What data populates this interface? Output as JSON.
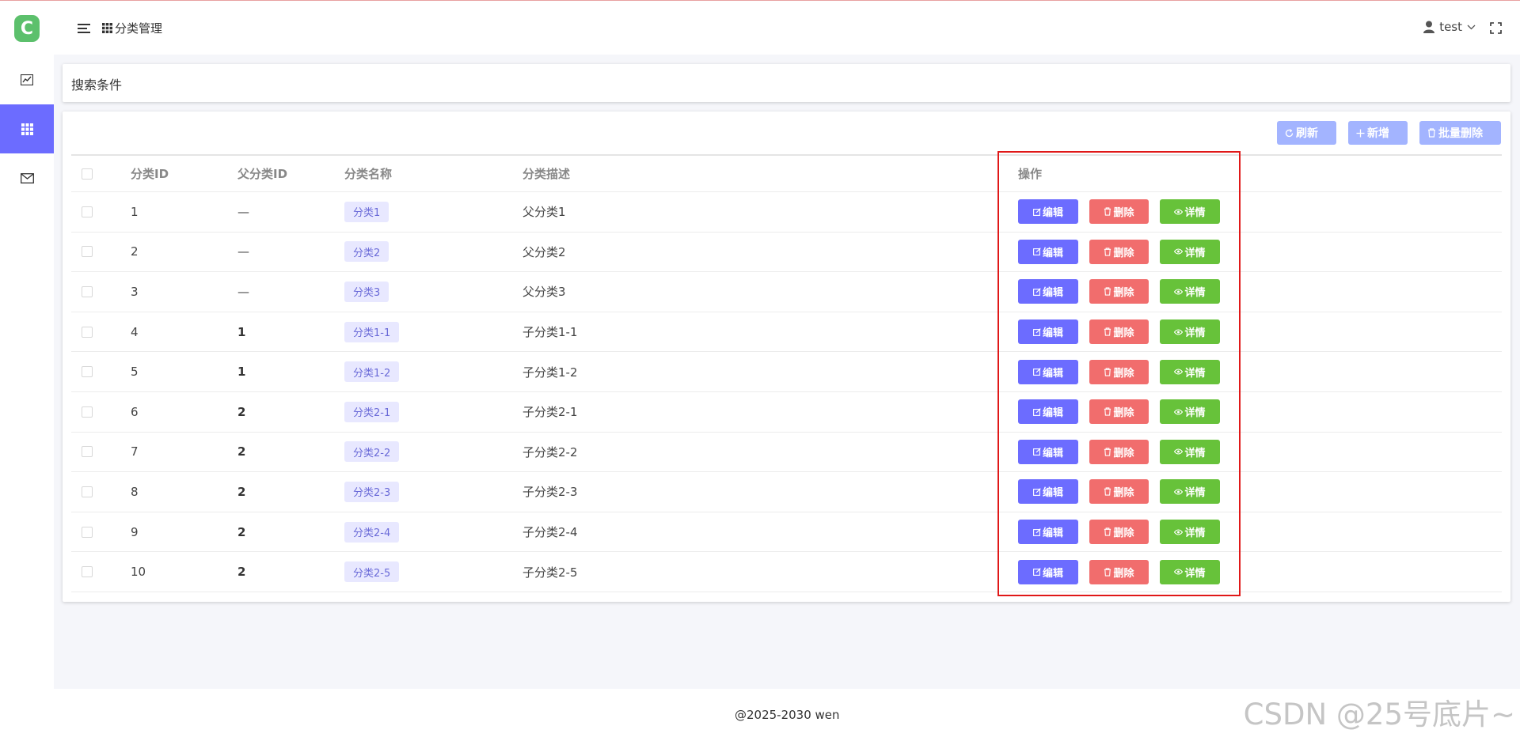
{
  "app": {
    "logo_letter": "C",
    "brand_color": "#5cc06c",
    "accent": "#6c6cff"
  },
  "sidebar": {
    "items": [
      {
        "name": "dashboard",
        "icon": "trend-chart-icon",
        "active": false
      },
      {
        "name": "category",
        "icon": "grid-icon",
        "active": true
      },
      {
        "name": "messages",
        "icon": "mail-icon",
        "active": false
      }
    ]
  },
  "header": {
    "breadcrumb": "分类管理",
    "user": "test"
  },
  "search": {
    "title": "搜索条件"
  },
  "toolbar": {
    "refresh": "刷新",
    "add": "新增",
    "batch_delete": "批量删除"
  },
  "table": {
    "headers": {
      "id": "分类ID",
      "parent_id": "父分类ID",
      "name": "分类名称",
      "desc": "分类描述",
      "ops": "操作"
    },
    "rows": [
      {
        "id": "1",
        "parent_id": "—",
        "name": "分类1",
        "desc": "父分类1"
      },
      {
        "id": "2",
        "parent_id": "—",
        "name": "分类2",
        "desc": "父分类2"
      },
      {
        "id": "3",
        "parent_id": "—",
        "name": "分类3",
        "desc": "父分类3"
      },
      {
        "id": "4",
        "parent_id": "1",
        "name": "分类1-1",
        "desc": "子分类1-1"
      },
      {
        "id": "5",
        "parent_id": "1",
        "name": "分类1-2",
        "desc": "子分类1-2"
      },
      {
        "id": "6",
        "parent_id": "2",
        "name": "分类2-1",
        "desc": "子分类2-1"
      },
      {
        "id": "7",
        "parent_id": "2",
        "name": "分类2-2",
        "desc": "子分类2-2"
      },
      {
        "id": "8",
        "parent_id": "2",
        "name": "分类2-3",
        "desc": "子分类2-3"
      },
      {
        "id": "9",
        "parent_id": "2",
        "name": "分类2-4",
        "desc": "子分类2-4"
      },
      {
        "id": "10",
        "parent_id": "2",
        "name": "分类2-5",
        "desc": "子分类2-5"
      }
    ],
    "actions": {
      "edit": "编辑",
      "delete": "删除",
      "detail": "详情"
    }
  },
  "footer": {
    "copyright": "@2025-2030 wen"
  },
  "watermark": "CSDN @25号底片~"
}
